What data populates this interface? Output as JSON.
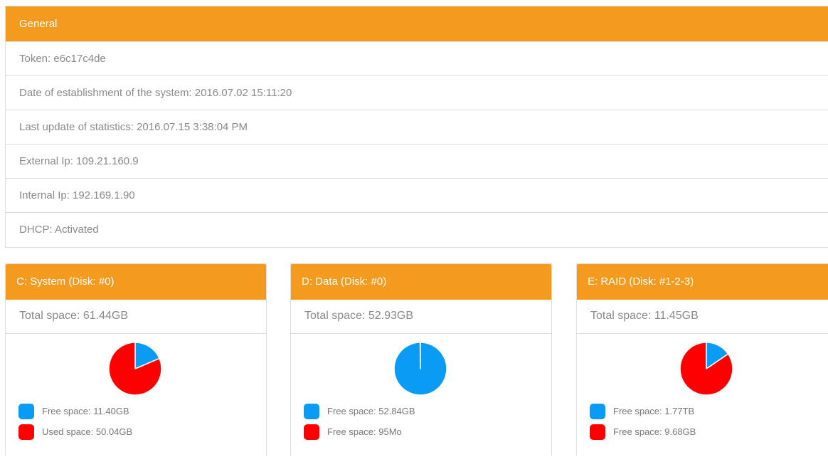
{
  "general": {
    "title": "General",
    "rows": [
      "Token: e6c17c4de",
      "Date of establishment of the system: 2016.07.02 15:11:20",
      "Last update of statistics: 2016.07.15 3:38:04 PM",
      "External Ip: 109.21.160.9",
      "Internal Ip: 192.169.1.90",
      "DHCP: Activated"
    ]
  },
  "colors": {
    "accent": "#f39a1f",
    "free": "#0a9cf5",
    "used": "#ff0000"
  },
  "disks": [
    {
      "title": "C: System (Disk: #0)",
      "total": "Total space: 61.44GB",
      "legend": [
        "Free space: 11.40GB",
        "Used space: 50.04GB"
      ],
      "free_fraction": 0.1855
    },
    {
      "title": "D: Data (Disk: #0)",
      "total": "Total space: 52.93GB",
      "legend": [
        "Free space: 52.84GB",
        "Free space: 95Mo"
      ],
      "free_fraction": 0.9982
    },
    {
      "title": "E: RAID (Disk: #1-2-3)",
      "total": "Total space: 11.45GB",
      "legend": [
        "Free space: 1.77TB",
        "Free space: 9.68GB"
      ],
      "free_fraction": 0.1546
    }
  ]
}
